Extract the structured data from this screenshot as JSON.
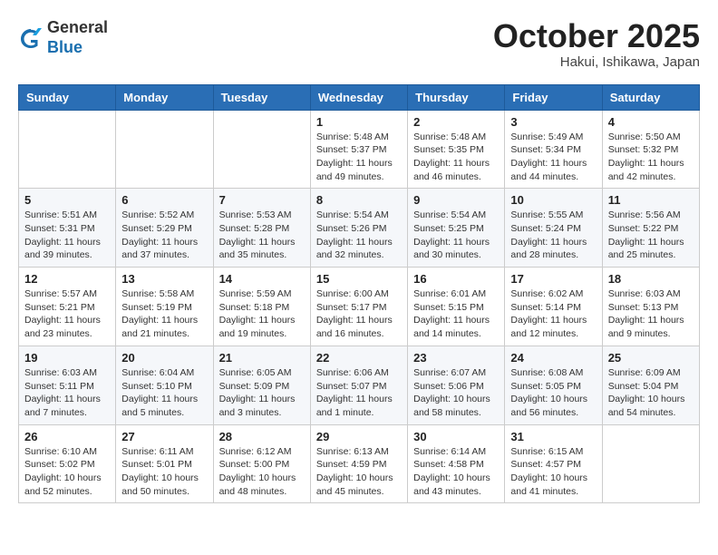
{
  "header": {
    "logo": {
      "line1": "General",
      "line2": "Blue"
    },
    "month": "October 2025",
    "location": "Hakui, Ishikawa, Japan"
  },
  "weekdays": [
    "Sunday",
    "Monday",
    "Tuesday",
    "Wednesday",
    "Thursday",
    "Friday",
    "Saturday"
  ],
  "weeks": [
    [
      {
        "day": "",
        "info": ""
      },
      {
        "day": "",
        "info": ""
      },
      {
        "day": "",
        "info": ""
      },
      {
        "day": "1",
        "info": "Sunrise: 5:48 AM\nSunset: 5:37 PM\nDaylight: 11 hours\nand 49 minutes."
      },
      {
        "day": "2",
        "info": "Sunrise: 5:48 AM\nSunset: 5:35 PM\nDaylight: 11 hours\nand 46 minutes."
      },
      {
        "day": "3",
        "info": "Sunrise: 5:49 AM\nSunset: 5:34 PM\nDaylight: 11 hours\nand 44 minutes."
      },
      {
        "day": "4",
        "info": "Sunrise: 5:50 AM\nSunset: 5:32 PM\nDaylight: 11 hours\nand 42 minutes."
      }
    ],
    [
      {
        "day": "5",
        "info": "Sunrise: 5:51 AM\nSunset: 5:31 PM\nDaylight: 11 hours\nand 39 minutes."
      },
      {
        "day": "6",
        "info": "Sunrise: 5:52 AM\nSunset: 5:29 PM\nDaylight: 11 hours\nand 37 minutes."
      },
      {
        "day": "7",
        "info": "Sunrise: 5:53 AM\nSunset: 5:28 PM\nDaylight: 11 hours\nand 35 minutes."
      },
      {
        "day": "8",
        "info": "Sunrise: 5:54 AM\nSunset: 5:26 PM\nDaylight: 11 hours\nand 32 minutes."
      },
      {
        "day": "9",
        "info": "Sunrise: 5:54 AM\nSunset: 5:25 PM\nDaylight: 11 hours\nand 30 minutes."
      },
      {
        "day": "10",
        "info": "Sunrise: 5:55 AM\nSunset: 5:24 PM\nDaylight: 11 hours\nand 28 minutes."
      },
      {
        "day": "11",
        "info": "Sunrise: 5:56 AM\nSunset: 5:22 PM\nDaylight: 11 hours\nand 25 minutes."
      }
    ],
    [
      {
        "day": "12",
        "info": "Sunrise: 5:57 AM\nSunset: 5:21 PM\nDaylight: 11 hours\nand 23 minutes."
      },
      {
        "day": "13",
        "info": "Sunrise: 5:58 AM\nSunset: 5:19 PM\nDaylight: 11 hours\nand 21 minutes."
      },
      {
        "day": "14",
        "info": "Sunrise: 5:59 AM\nSunset: 5:18 PM\nDaylight: 11 hours\nand 19 minutes."
      },
      {
        "day": "15",
        "info": "Sunrise: 6:00 AM\nSunset: 5:17 PM\nDaylight: 11 hours\nand 16 minutes."
      },
      {
        "day": "16",
        "info": "Sunrise: 6:01 AM\nSunset: 5:15 PM\nDaylight: 11 hours\nand 14 minutes."
      },
      {
        "day": "17",
        "info": "Sunrise: 6:02 AM\nSunset: 5:14 PM\nDaylight: 11 hours\nand 12 minutes."
      },
      {
        "day": "18",
        "info": "Sunrise: 6:03 AM\nSunset: 5:13 PM\nDaylight: 11 hours\nand 9 minutes."
      }
    ],
    [
      {
        "day": "19",
        "info": "Sunrise: 6:03 AM\nSunset: 5:11 PM\nDaylight: 11 hours\nand 7 minutes."
      },
      {
        "day": "20",
        "info": "Sunrise: 6:04 AM\nSunset: 5:10 PM\nDaylight: 11 hours\nand 5 minutes."
      },
      {
        "day": "21",
        "info": "Sunrise: 6:05 AM\nSunset: 5:09 PM\nDaylight: 11 hours\nand 3 minutes."
      },
      {
        "day": "22",
        "info": "Sunrise: 6:06 AM\nSunset: 5:07 PM\nDaylight: 11 hours\nand 1 minute."
      },
      {
        "day": "23",
        "info": "Sunrise: 6:07 AM\nSunset: 5:06 PM\nDaylight: 10 hours\nand 58 minutes."
      },
      {
        "day": "24",
        "info": "Sunrise: 6:08 AM\nSunset: 5:05 PM\nDaylight: 10 hours\nand 56 minutes."
      },
      {
        "day": "25",
        "info": "Sunrise: 6:09 AM\nSunset: 5:04 PM\nDaylight: 10 hours\nand 54 minutes."
      }
    ],
    [
      {
        "day": "26",
        "info": "Sunrise: 6:10 AM\nSunset: 5:02 PM\nDaylight: 10 hours\nand 52 minutes."
      },
      {
        "day": "27",
        "info": "Sunrise: 6:11 AM\nSunset: 5:01 PM\nDaylight: 10 hours\nand 50 minutes."
      },
      {
        "day": "28",
        "info": "Sunrise: 6:12 AM\nSunset: 5:00 PM\nDaylight: 10 hours\nand 48 minutes."
      },
      {
        "day": "29",
        "info": "Sunrise: 6:13 AM\nSunset: 4:59 PM\nDaylight: 10 hours\nand 45 minutes."
      },
      {
        "day": "30",
        "info": "Sunrise: 6:14 AM\nSunset: 4:58 PM\nDaylight: 10 hours\nand 43 minutes."
      },
      {
        "day": "31",
        "info": "Sunrise: 6:15 AM\nSunset: 4:57 PM\nDaylight: 10 hours\nand 41 minutes."
      },
      {
        "day": "",
        "info": ""
      }
    ]
  ]
}
